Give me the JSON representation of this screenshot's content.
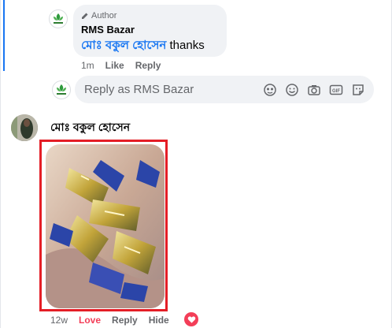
{
  "reply": {
    "author_badge": "Author",
    "name": "RMS Bazar",
    "mention": "মোঃ বকুল হোসেন",
    "text": " thanks",
    "time": "1m",
    "like": "Like",
    "reply": "Reply"
  },
  "reply_input": {
    "placeholder": "Reply as RMS Bazar",
    "icons": [
      "sticker-face-icon",
      "emoji-icon",
      "camera-icon",
      "gif-icon",
      "sticker-icon"
    ]
  },
  "comment": {
    "user_name": "মোঃ বকুল হোসেন",
    "time": "12w",
    "love": "Love",
    "reply": "Reply",
    "hide": "Hide"
  },
  "colors": {
    "accent": "#1876f2",
    "love": "#f33e58",
    "highlight_border": "#e41e26"
  }
}
